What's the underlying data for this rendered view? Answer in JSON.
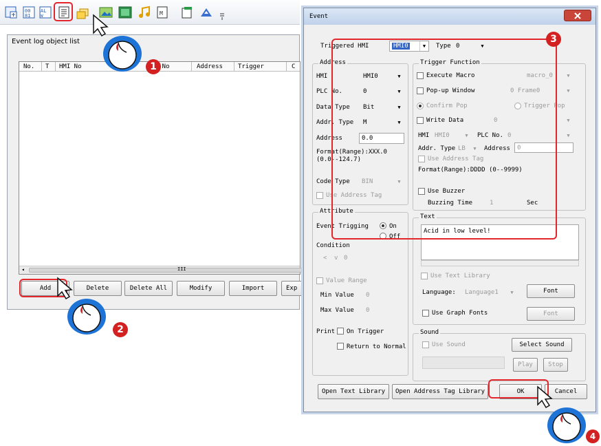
{
  "toolbar": {
    "icons": [
      "event-table-icon",
      "numeric-display-icon",
      "alarm-list-icon",
      "event-log-icon",
      "layers-icon",
      "picture-icon",
      "image-icon",
      "music-icon",
      "text-icon",
      "document-icon",
      "marker-icon",
      "overflow-icon"
    ]
  },
  "event_log_window": {
    "title": "Event log object list",
    "columns": [
      "No.",
      "T",
      "HMI No",
      "",
      "PLC No",
      "Address",
      "Trigger",
      "C"
    ],
    "scroll_marker": "III",
    "buttons": {
      "add": "Add",
      "delete": "Delete",
      "delete_all": "Delete All",
      "modify": "Modify",
      "import": "Import",
      "export": "Exp"
    }
  },
  "event_dialog": {
    "title": "Event",
    "triggered_hmi_label": "Triggered HMI",
    "triggered_hmi_value": "HMI0",
    "type_label": "Type",
    "type_value": "0",
    "address_group": {
      "title": "Address",
      "hmi_label": "HMI",
      "hmi_value": "HMI0",
      "plc_label": "PLC No.",
      "plc_value": "0",
      "data_type_label": "Data Type",
      "data_type_value": "Bit",
      "addr_type_label": "Addr. Type",
      "addr_type_value": "M",
      "address_label": "Address",
      "address_value": "0.0",
      "format_text": "Format(Range):XXX.0\n(0.0--124.7)",
      "code_type_label": "Code Type",
      "code_type_value": "BIN",
      "use_address_tag": "Use Address Tag"
    },
    "attribute_group": {
      "title": "Attribute",
      "event_trigger_label": "Event Trigging",
      "on_label": "On",
      "off_label": "Off",
      "condition_label": "Condition",
      "condition_op": "<",
      "condition_arrow": "v",
      "condition_value": "0",
      "value_range": "Value Range",
      "min_label": "Min Value",
      "min_value": "0",
      "max_label": "Max Value",
      "max_value": "0",
      "print_label": "Print",
      "on_trigger": "On Trigger",
      "return_normal": "Return to Normal"
    },
    "trigger_group": {
      "title": "Trigger Function",
      "execute_macro": "Execute Macro",
      "macro_value": "macro_0",
      "popup_window": "Pop-up Window",
      "popup_value": "0 Frame0",
      "confirm_pop": "Confirm Pop",
      "trigger_pop": "Trigger Pop",
      "write_data": "Write Data",
      "write_value": "0",
      "hmi_label": "HMI",
      "hmi_value": "HMI0",
      "plc_label": "PLC No.",
      "plc_value": "0",
      "addr_type_label": "Addr. Type",
      "addr_type_value": "LB",
      "address_label": "Address",
      "address_value": "0",
      "use_address_tag": "Use Address Tag",
      "format_text": "Format(Range):DDDD (0--9999)",
      "use_buzzer": "Use Buzzer",
      "buzzing_time_label": "Buzzing Time",
      "buzzing_time_value": "1",
      "buzzing_unit": "Sec"
    },
    "text_group": {
      "title": "Text",
      "text_value": "Acid in low level!",
      "use_text_library": "Use Text Library",
      "language_label": "Language:",
      "language_value": "Language1",
      "font_button": "Font",
      "use_graph_fonts": "Use Graph Fonts",
      "font_button2": "Font"
    },
    "sound_group": {
      "title": "Sound",
      "use_sound": "Use Sound",
      "select_sound": "Select Sound",
      "play": "Play",
      "stop": "Stop"
    },
    "footer": {
      "open_text_library": "Open Text Library",
      "open_address_tag_library": "Open Address Tag Library",
      "ok": "OK",
      "cancel": "Cancel"
    }
  },
  "badges": [
    "1",
    "2",
    "3",
    "4"
  ],
  "colors": {
    "highlight": "#e3262c",
    "badge": "#d32021",
    "mouse": "#1e73d6",
    "dialog_bg": "#f0f0f0"
  }
}
